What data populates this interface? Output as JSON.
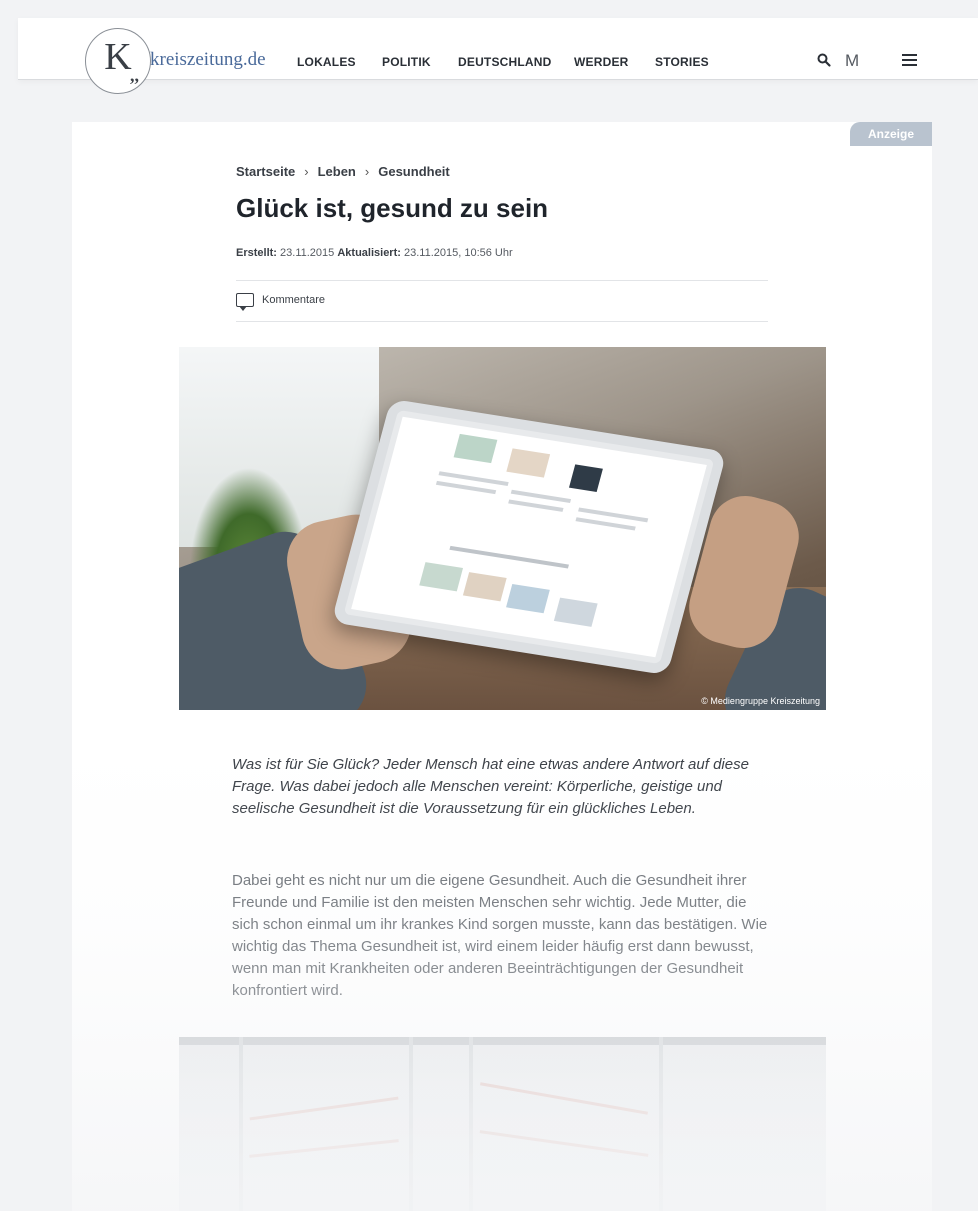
{
  "header": {
    "site_name": "kreiszeitung.de",
    "logo_letter": "K",
    "logo_quote": ",,",
    "nav": [
      "LOKALES",
      "POLITIK",
      "DEUTSCHLAND",
      "WERDER",
      "STORIES"
    ],
    "merkliste_label": "M"
  },
  "ad_badge": "Anzeige",
  "breadcrumb": [
    "Startseite",
    "Leben",
    "Gesundheit"
  ],
  "breadcrumb_sep": "›",
  "article": {
    "title": "Glück ist, gesund zu sein",
    "created_label": "Erstellt:",
    "created": "23.11.2015",
    "updated_label": "Aktualisiert:",
    "updated": "23.11.2015, 10:56 Uhr",
    "comments_label": "Kommentare",
    "image_credit": "© Mediengruppe Kreiszeitung",
    "lead": "Was ist für Sie Glück? Jeder Mensch hat eine etwas andere Antwort auf diese Frage. Was dabei jedoch alle Menschen vereint: Körperliche, geistige und seelische Gesundheit ist die Voraussetzung für ein glückliches Leben.",
    "body": "Dabei geht es nicht nur um die eigene Gesundheit. Auch die Gesundheit ihrer Freunde und Familie ist den meisten Menschen sehr wichtig. Jede Mutter, die sich schon einmal um ihr krankes Kind sorgen musste, kann das bestätigen. Wie wichtig das Thema Gesundheit ist, wird einem leider häufig erst dann bewusst, wenn man mit Krankheiten oder anderen Beeinträchtigungen der Gesundheit konfrontiert wird."
  },
  "colors": {
    "accent": "#4a6a9a",
    "ad_badge_bg": "#b9c3cf",
    "page_bg": "#f2f3f5"
  }
}
